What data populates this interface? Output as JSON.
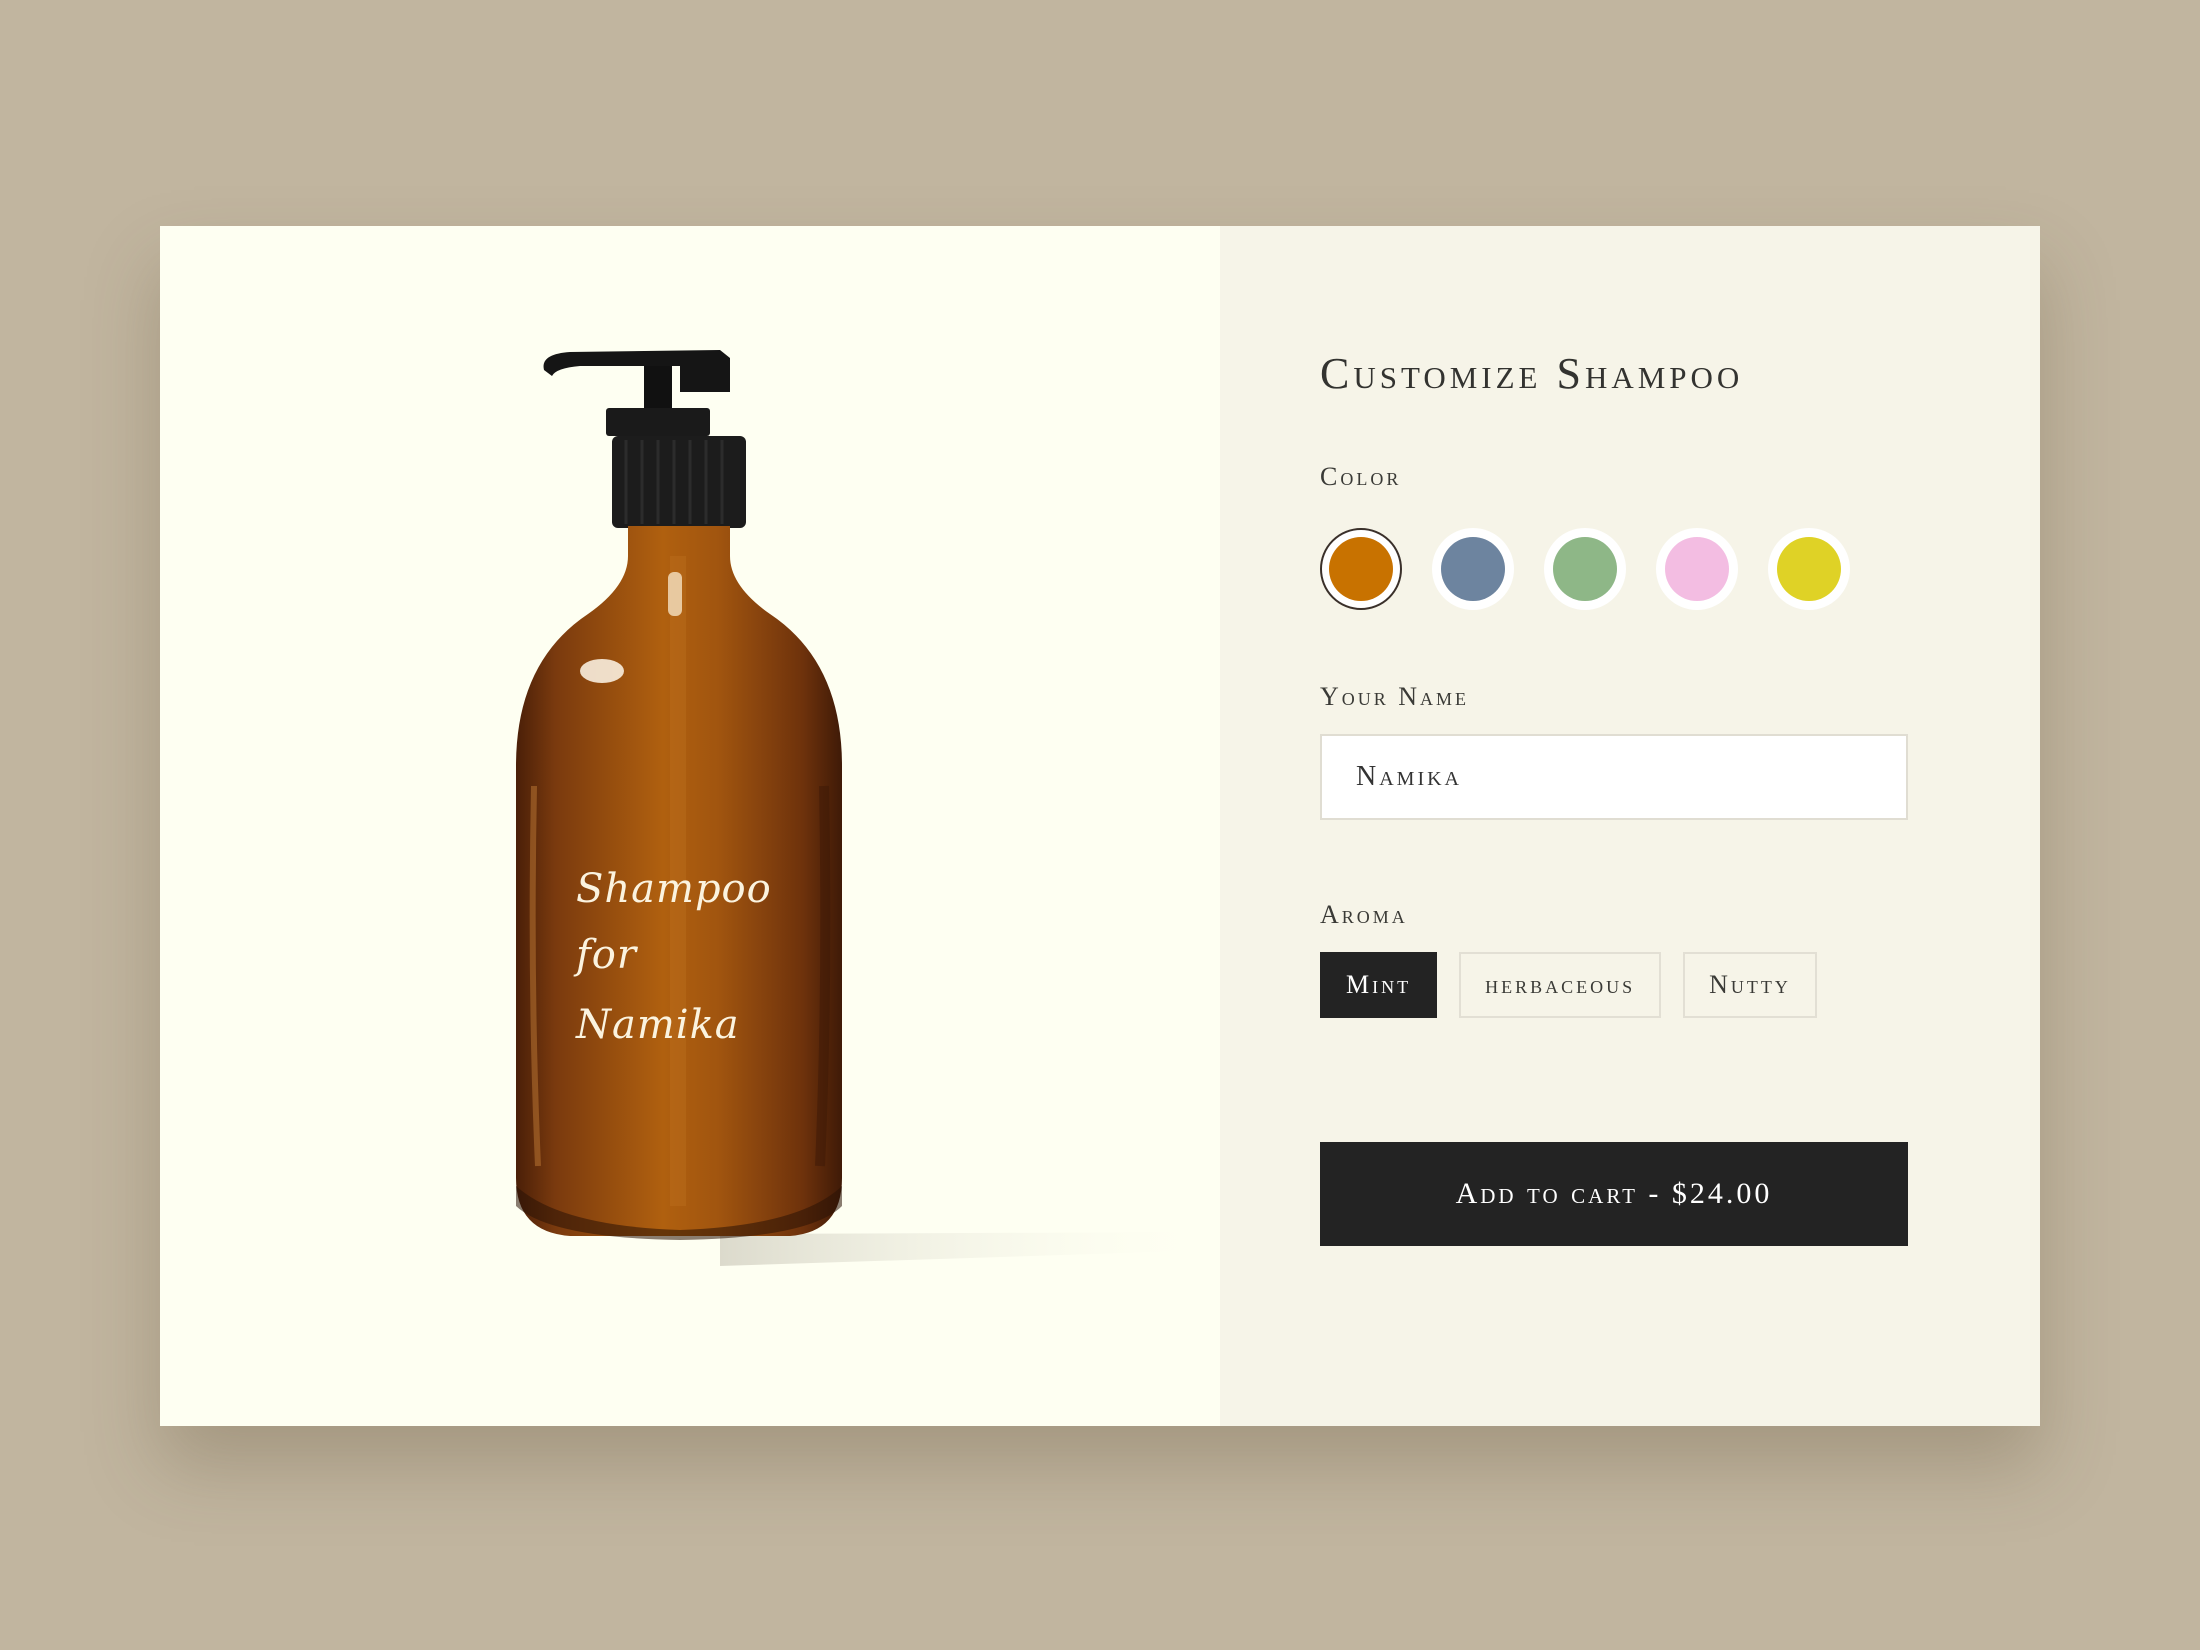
{
  "product": {
    "bottle_lines": [
      "Shampoo",
      "for",
      "Namika"
    ]
  },
  "form": {
    "title": "Customize Shampoo",
    "color_label": "Color",
    "colors": [
      {
        "name": "amber",
        "hex": "#c87200",
        "selected": true
      },
      {
        "name": "slate-blue",
        "hex": "#6d849f",
        "selected": false
      },
      {
        "name": "sage-green",
        "hex": "#8eb787",
        "selected": false
      },
      {
        "name": "pink",
        "hex": "#f3bde2",
        "selected": false
      },
      {
        "name": "yellow",
        "hex": "#dfd226",
        "selected": false
      }
    ],
    "name_label": "Your Name",
    "name_value": "Namika",
    "aroma_label": "Aroma",
    "aromas": [
      {
        "label": "Mint",
        "selected": true
      },
      {
        "label": "herbaceous",
        "selected": false
      },
      {
        "label": "Nutty",
        "selected": false
      }
    ],
    "add_to_cart_label": "Add to cart - $24.00"
  },
  "theme": {
    "page_background": "#c1b59f",
    "image_panel_background": "#fefff2",
    "form_panel_background": "#f6f4e8",
    "primary_dark": "#232323"
  }
}
